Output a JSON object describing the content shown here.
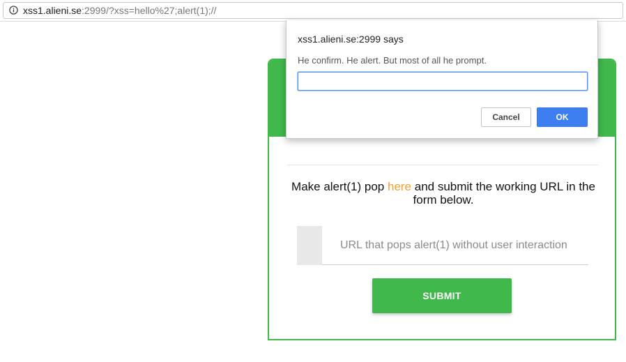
{
  "browser": {
    "url_host": "xss1.alieni.se",
    "url_rest": ":2999/?xss=hello%27;alert(1);//",
    "info_icon": "info-icon"
  },
  "dialog": {
    "title": "xss1.alieni.se:2999 says",
    "message": "He confirm. He alert. But most of all he prompt.",
    "input_value": "",
    "cancel_label": "Cancel",
    "ok_label": "OK"
  },
  "card": {
    "instruction_before": "Make alert(1) pop ",
    "link_text": "here",
    "instruction_after": " and submit the working URL in the form below.",
    "input_placeholder": "URL that pops alert(1) without user interaction",
    "input_value": "",
    "submit_label": "SUBMIT"
  },
  "colors": {
    "accent_green": "#41b84c",
    "link_orange": "#f0a131",
    "ok_blue": "#3d7ff0"
  }
}
